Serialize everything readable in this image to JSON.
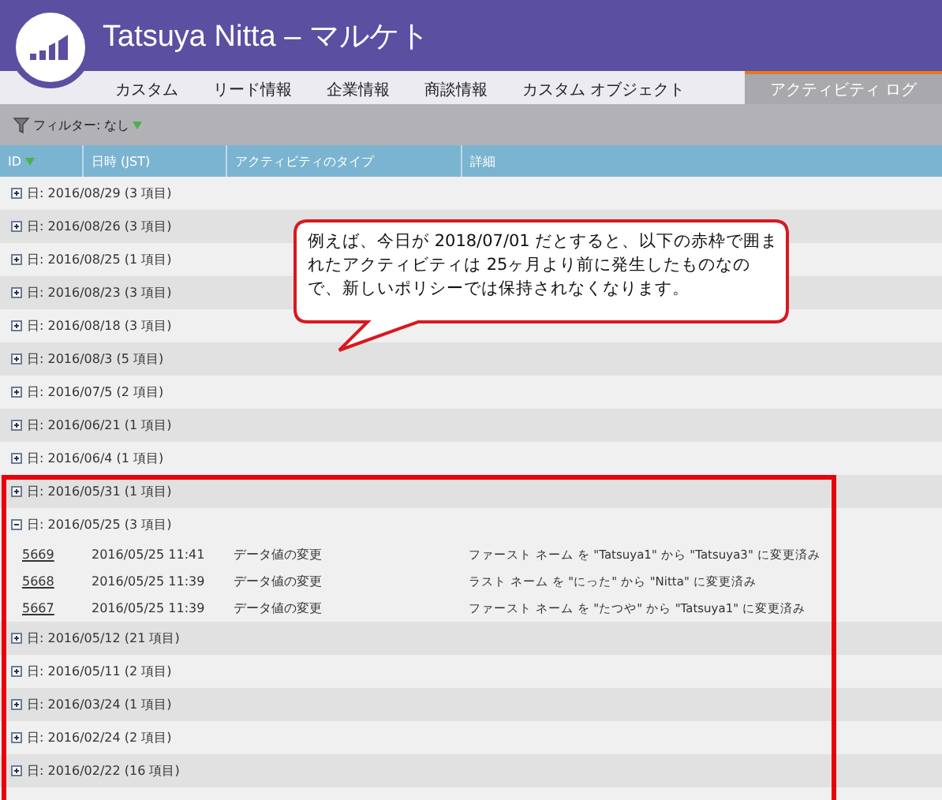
{
  "window": {
    "title": "Tatsuya Nitta – マルケト"
  },
  "tabs": [
    {
      "label": "カスタム",
      "selected": false
    },
    {
      "label": "リード情報",
      "selected": false
    },
    {
      "label": "企業情報",
      "selected": false
    },
    {
      "label": "商談情報",
      "selected": false
    },
    {
      "label": "カスタム オブジェクト",
      "selected": false
    },
    {
      "label": "アクティビティ ログ",
      "selected": true
    }
  ],
  "filter": {
    "label": "フィルター: なし"
  },
  "table": {
    "columns": [
      "ID",
      "日時 (JST)",
      "アクティビティのタイプ",
      "詳細"
    ],
    "groups": [
      {
        "label": "日: 2016/08/29 (3 項目)",
        "expanded": false
      },
      {
        "label": "日: 2016/08/26 (3 項目)",
        "expanded": false
      },
      {
        "label": "日: 2016/08/25 (1 項目)",
        "expanded": false
      },
      {
        "label": "日: 2016/08/23 (3 項目)",
        "expanded": false
      },
      {
        "label": "日: 2016/08/18 (3 項目)",
        "expanded": false
      },
      {
        "label": "日: 2016/08/3 (5 項目)",
        "expanded": false
      },
      {
        "label": "日: 2016/07/5 (2 項目)",
        "expanded": false
      },
      {
        "label": "日: 2016/06/21 (1 項目)",
        "expanded": false
      },
      {
        "label": "日: 2016/06/4 (1 項目)",
        "expanded": false
      }
    ],
    "highlighted_groups": [
      {
        "label": "日: 2016/05/31 (1 項目)",
        "expanded": false
      },
      {
        "label": "日: 2016/05/25 (3 項目)",
        "expanded": true,
        "rows": [
          {
            "id": "5669",
            "datetime": "2016/05/25 11:41",
            "type": "データ値の変更",
            "detail": "ファースト ネーム を \"Tatsuya1\" から \"Tatsuya3\" に変更済み"
          },
          {
            "id": "5668",
            "datetime": "2016/05/25 11:39",
            "type": "データ値の変更",
            "detail": "ラスト ネーム を \"にった\" から \"Nitta\" に変更済み"
          },
          {
            "id": "5667",
            "datetime": "2016/05/25 11:39",
            "type": "データ値の変更",
            "detail": "ファースト ネーム を \"たつや\" から \"Tatsuya1\" に変更済み"
          }
        ]
      },
      {
        "label": "日: 2016/05/12 (21 項目)",
        "expanded": false
      },
      {
        "label": "日: 2016/05/11 (2 項目)",
        "expanded": false
      },
      {
        "label": "日: 2016/03/24 (1 項目)",
        "expanded": false
      },
      {
        "label": "日: 2016/02/24 (2 項目)",
        "expanded": false
      },
      {
        "label": "日: 2016/02/22 (16 項目)",
        "expanded": false
      }
    ]
  },
  "callout": {
    "text": "例えば、今日が 2018/07/01 だとすると、以下の赤枠で囲まれたアクティビティは 25ヶ月より前に発生したものなので、新しいポリシーでは保持されなくなります。"
  }
}
